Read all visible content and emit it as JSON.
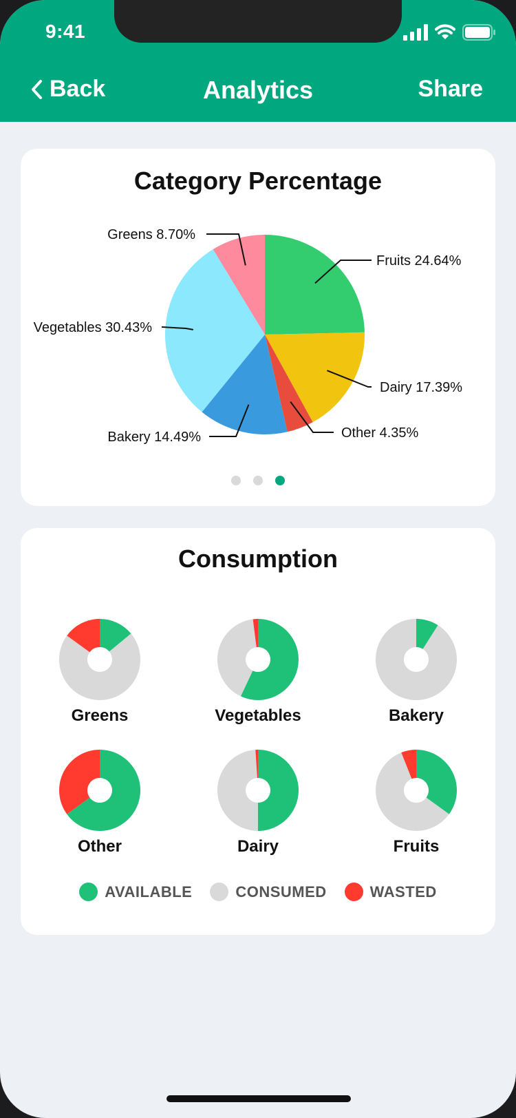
{
  "status_bar": {
    "time": "9:41"
  },
  "nav": {
    "back_label": "Back",
    "title": "Analytics",
    "share_label": "Share"
  },
  "colors": {
    "header": "#01a77e",
    "available": "#1ec177",
    "consumed": "#d9d9d9",
    "wasted": "#ff3b30"
  },
  "pager": {
    "pages": 3,
    "active": 3
  },
  "chart_data": [
    {
      "type": "pie",
      "title": "Category Percentage",
      "slices": [
        {
          "name": "Fruits",
          "label": "Fruits 24.64%",
          "value": 24.64,
          "color": "#33cd6f"
        },
        {
          "name": "Dairy",
          "label": "Dairy 17.39%",
          "value": 17.39,
          "color": "#f1c40f"
        },
        {
          "name": "Other",
          "label": "Other 4.35%",
          "value": 4.35,
          "color": "#e74c3c"
        },
        {
          "name": "Bakery",
          "label": "Bakery 14.49%",
          "value": 14.49,
          "color": "#3a9ade"
        },
        {
          "name": "Vegetables",
          "label": "Vegetables 30.43%",
          "value": 30.43,
          "color": "#8ce8fd"
        },
        {
          "name": "Greens",
          "label": "Greens 8.70%",
          "value": 8.7,
          "color": "#fd8b9d"
        }
      ]
    },
    {
      "type": "pie",
      "title": "Consumption",
      "legend": [
        "AVAILABLE",
        "CONSUMED",
        "WASTED"
      ],
      "categories": [
        "Greens",
        "Vegetables",
        "Bakery",
        "Other",
        "Dairy",
        "Fruits"
      ],
      "series": [
        {
          "name": "AVAILABLE",
          "values": [
            0.14,
            0.57,
            0.09,
            0.65,
            0.5,
            0.35
          ]
        },
        {
          "name": "CONSUMED",
          "values": [
            0.71,
            0.41,
            0.91,
            0.0,
            0.49,
            0.59
          ]
        },
        {
          "name": "WASTED",
          "values": [
            0.15,
            0.02,
            0.0,
            0.35,
            0.01,
            0.06
          ]
        }
      ]
    }
  ]
}
